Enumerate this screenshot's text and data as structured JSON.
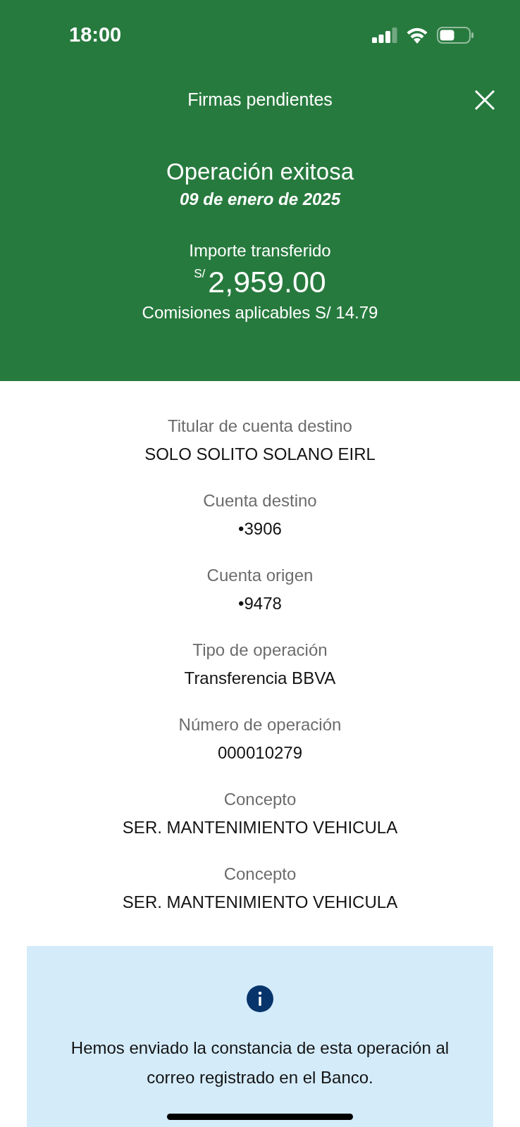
{
  "status_bar": {
    "time": "18:00"
  },
  "header": {
    "title": "Firmas pendientes"
  },
  "result": {
    "title": "Operación exitosa",
    "date": "09 de enero de 2025",
    "amount_label": "Importe transferido",
    "currency": "S/",
    "amount": "2,959.00",
    "fees": "Comisiones aplicables S/ 14.79"
  },
  "details": [
    {
      "label": "Titular de cuenta destino",
      "value": "SOLO SOLITO SOLANO EIRL"
    },
    {
      "label": "Cuenta destino",
      "value": "•3906"
    },
    {
      "label": "Cuenta origen",
      "value": "•9478"
    },
    {
      "label": "Tipo de operación",
      "value": "Transferencia BBVA"
    },
    {
      "label": "Número de operación",
      "value": "000010279"
    },
    {
      "label": "Concepto",
      "value": "SER. MANTENIMIENTO VEHICULA"
    },
    {
      "label": "Concepto",
      "value": "SER. MANTENIMIENTO VEHICULA"
    }
  ],
  "notice": {
    "text": "Hemos enviado la constancia de esta operación al correo registrado en el Banco."
  }
}
